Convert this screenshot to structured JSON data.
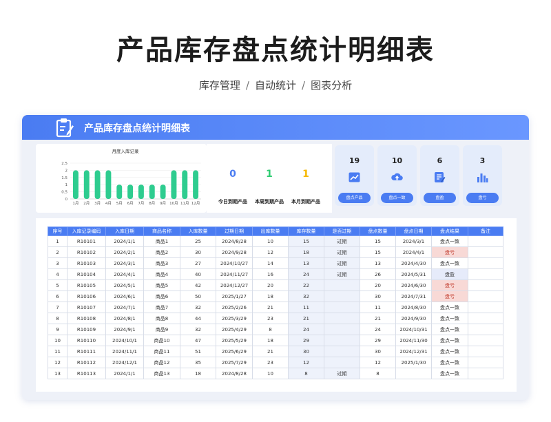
{
  "page": {
    "title": "产品库存盘点统计明细表",
    "subtitle": [
      "库存管理",
      "自动统计",
      "图表分析"
    ],
    "separator": "/"
  },
  "banner": {
    "title": "产品库存盘点统计明细表"
  },
  "chart_data": {
    "type": "bar",
    "title": "月度入库记录",
    "categories": [
      "1月",
      "2月",
      "3月",
      "4月",
      "5月",
      "6月",
      "7月",
      "8月",
      "9月",
      "10月",
      "11月",
      "12月"
    ],
    "values": [
      2,
      2,
      2,
      2,
      1,
      1,
      1,
      1,
      1,
      2,
      2,
      2
    ],
    "ylim": [
      0,
      2.5
    ],
    "yticks": [
      "0",
      "0.5",
      "1",
      "1.5",
      "2",
      "2.5"
    ],
    "color": "#2ecc8f"
  },
  "kpis": [
    {
      "value": "0",
      "label": "今日到期产品",
      "color": "#4a7cf2"
    },
    {
      "value": "1",
      "label": "本周到期产品",
      "color": "#2ecc71"
    },
    {
      "value": "1",
      "label": "本月到期产品",
      "color": "#f5b800"
    }
  ],
  "cards": [
    {
      "value": "19",
      "button": "盘点产品",
      "icon": "trend-chart-icon"
    },
    {
      "value": "10",
      "button": "盘点一致",
      "icon": "upload-cloud-icon"
    },
    {
      "value": "6",
      "button": "盘盈",
      "icon": "edit-document-icon"
    },
    {
      "value": "3",
      "button": "盘亏",
      "icon": "bar-chart-icon"
    }
  ],
  "table": {
    "headers": [
      "序号",
      "入库记录编码",
      "入库日期",
      "商品名称",
      "入库数量",
      "过期日期",
      "出库数量",
      "库存数量",
      "是否过期",
      "盘点数量",
      "盘点日期",
      "盘点结果",
      "备注"
    ],
    "rows": [
      [
        "1",
        "R10101",
        "2024/1/1",
        "商品1",
        "25",
        "2024/8/28",
        "10",
        "15",
        "过期",
        "15",
        "2024/3/1",
        "盘点一致",
        ""
      ],
      [
        "2",
        "R10102",
        "2024/2/1",
        "商品2",
        "30",
        "2024/9/28",
        "12",
        "18",
        "过期",
        "15",
        "2024/4/1",
        "盘亏",
        ""
      ],
      [
        "3",
        "R10103",
        "2024/3/1",
        "商品3",
        "27",
        "2024/10/27",
        "14",
        "13",
        "过期",
        "13",
        "2024/4/30",
        "盘点一致",
        ""
      ],
      [
        "4",
        "R10104",
        "2024/4/1",
        "商品4",
        "40",
        "2024/11/27",
        "16",
        "24",
        "过期",
        "26",
        "2024/5/31",
        "盘盈",
        ""
      ],
      [
        "5",
        "R10105",
        "2024/5/1",
        "商品5",
        "42",
        "2024/12/27",
        "20",
        "22",
        "",
        "20",
        "2024/6/30",
        "盘亏",
        ""
      ],
      [
        "6",
        "R10106",
        "2024/6/1",
        "商品6",
        "50",
        "2025/1/27",
        "18",
        "32",
        "",
        "30",
        "2024/7/31",
        "盘亏",
        ""
      ],
      [
        "7",
        "R10107",
        "2024/7/1",
        "商品7",
        "32",
        "2025/2/26",
        "21",
        "11",
        "",
        "11",
        "2024/8/30",
        "盘点一致",
        ""
      ],
      [
        "8",
        "R10108",
        "2024/8/1",
        "商品8",
        "44",
        "2025/3/29",
        "23",
        "21",
        "",
        "21",
        "2024/9/30",
        "盘点一致",
        ""
      ],
      [
        "9",
        "R10109",
        "2024/9/1",
        "商品9",
        "32",
        "2025/4/29",
        "8",
        "24",
        "",
        "24",
        "2024/10/31",
        "盘点一致",
        ""
      ],
      [
        "10",
        "R10110",
        "2024/10/1",
        "商品10",
        "47",
        "2025/5/29",
        "18",
        "29",
        "",
        "29",
        "2024/11/30",
        "盘点一致",
        ""
      ],
      [
        "11",
        "R10111",
        "2024/11/1",
        "商品11",
        "51",
        "2025/6/29",
        "21",
        "30",
        "",
        "30",
        "2024/12/31",
        "盘点一致",
        ""
      ],
      [
        "12",
        "R10112",
        "2024/12/1",
        "商品12",
        "35",
        "2025/7/29",
        "23",
        "12",
        "",
        "12",
        "2025/1/30",
        "盘点一致",
        ""
      ],
      [
        "13",
        "R10113",
        "2024/1/1",
        "商品13",
        "18",
        "2024/8/28",
        "10",
        "8",
        "过期",
        "8",
        "",
        "盘点一致",
        ""
      ]
    ]
  }
}
